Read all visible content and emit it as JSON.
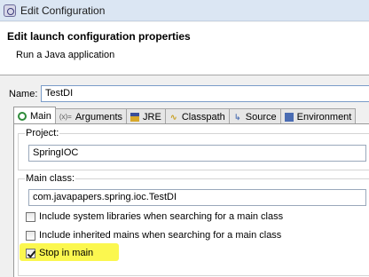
{
  "window": {
    "title": "Edit Configuration"
  },
  "header": {
    "title": "Edit launch configuration properties",
    "subtitle": "Run a Java application"
  },
  "name_field": {
    "label": "Name:",
    "value": "TestDI"
  },
  "tabs": [
    {
      "label": "Main",
      "icon": "main-tab-icon",
      "active": true
    },
    {
      "label": "Arguments",
      "icon": "arguments-icon",
      "active": false
    },
    {
      "label": "JRE",
      "icon": "jre-icon",
      "active": false
    },
    {
      "label": "Classpath",
      "icon": "classpath-icon",
      "active": false
    },
    {
      "label": "Source",
      "icon": "source-icon",
      "active": false
    },
    {
      "label": "Environment",
      "icon": "environment-icon",
      "active": false
    }
  ],
  "main_tab": {
    "project": {
      "label": "Project:",
      "value": "SpringIOC"
    },
    "main_class": {
      "label": "Main class:",
      "value": "com.javapapers.spring.ioc.TestDI"
    },
    "options": [
      {
        "label": "Include system libraries when searching for a main class",
        "checked": false
      },
      {
        "label": "Include inherited mains when searching for a main class",
        "checked": false
      },
      {
        "label": "Stop in main",
        "checked": true
      }
    ]
  },
  "colors": {
    "highlight": "#fbf74f",
    "active_tab_icon": "#2e8b3a"
  }
}
